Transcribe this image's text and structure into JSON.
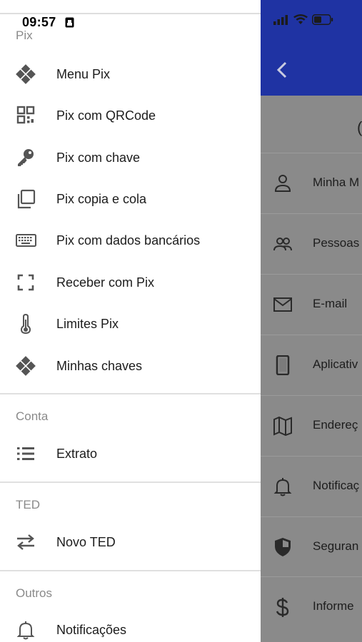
{
  "status_bar": {
    "time": "09:57"
  },
  "drawer": {
    "sections": [
      {
        "title": "Pix",
        "items": [
          {
            "label": "Menu Pix",
            "icon": "pix-diamond-icon"
          },
          {
            "label": "Pix com QRCode",
            "icon": "qrcode-icon"
          },
          {
            "label": "Pix com chave",
            "icon": "key-icon"
          },
          {
            "label": "Pix copia e cola",
            "icon": "copy-icon"
          },
          {
            "label": "Pix com dados bancários",
            "icon": "keyboard-icon"
          },
          {
            "label": "Receber com Pix",
            "icon": "scan-frame-icon"
          },
          {
            "label": "Limites Pix",
            "icon": "thermometer-icon"
          },
          {
            "label": "Minhas chaves",
            "icon": "pix-diamond-icon"
          }
        ]
      },
      {
        "title": "Conta",
        "items": [
          {
            "label": "Extrato",
            "icon": "list-icon"
          }
        ]
      },
      {
        "title": "TED",
        "items": [
          {
            "label": "Novo TED",
            "icon": "transfer-arrows-icon"
          }
        ]
      },
      {
        "title": "Outros",
        "items": [
          {
            "label": "Notificações",
            "icon": "bell-icon"
          }
        ]
      }
    ]
  },
  "background_screen": {
    "title_fragment": "(",
    "rows": [
      {
        "label": "Minha M",
        "icon": "person-icon"
      },
      {
        "label": "Pessoas",
        "icon": "people-icon"
      },
      {
        "label": "E-mail",
        "icon": "mail-icon"
      },
      {
        "label": "Aplicativ",
        "icon": "phone-icon"
      },
      {
        "label": "Endereç",
        "icon": "map-icon"
      },
      {
        "label": "Notificaç",
        "icon": "bell-icon"
      },
      {
        "label": "Seguran",
        "icon": "shield-icon"
      },
      {
        "label": "Informe",
        "icon": "dollar-icon"
      }
    ]
  },
  "colors": {
    "header_blue": "#1f33a3",
    "overlay_gray": "#8a8a8a",
    "icon_gray": "#555555"
  }
}
